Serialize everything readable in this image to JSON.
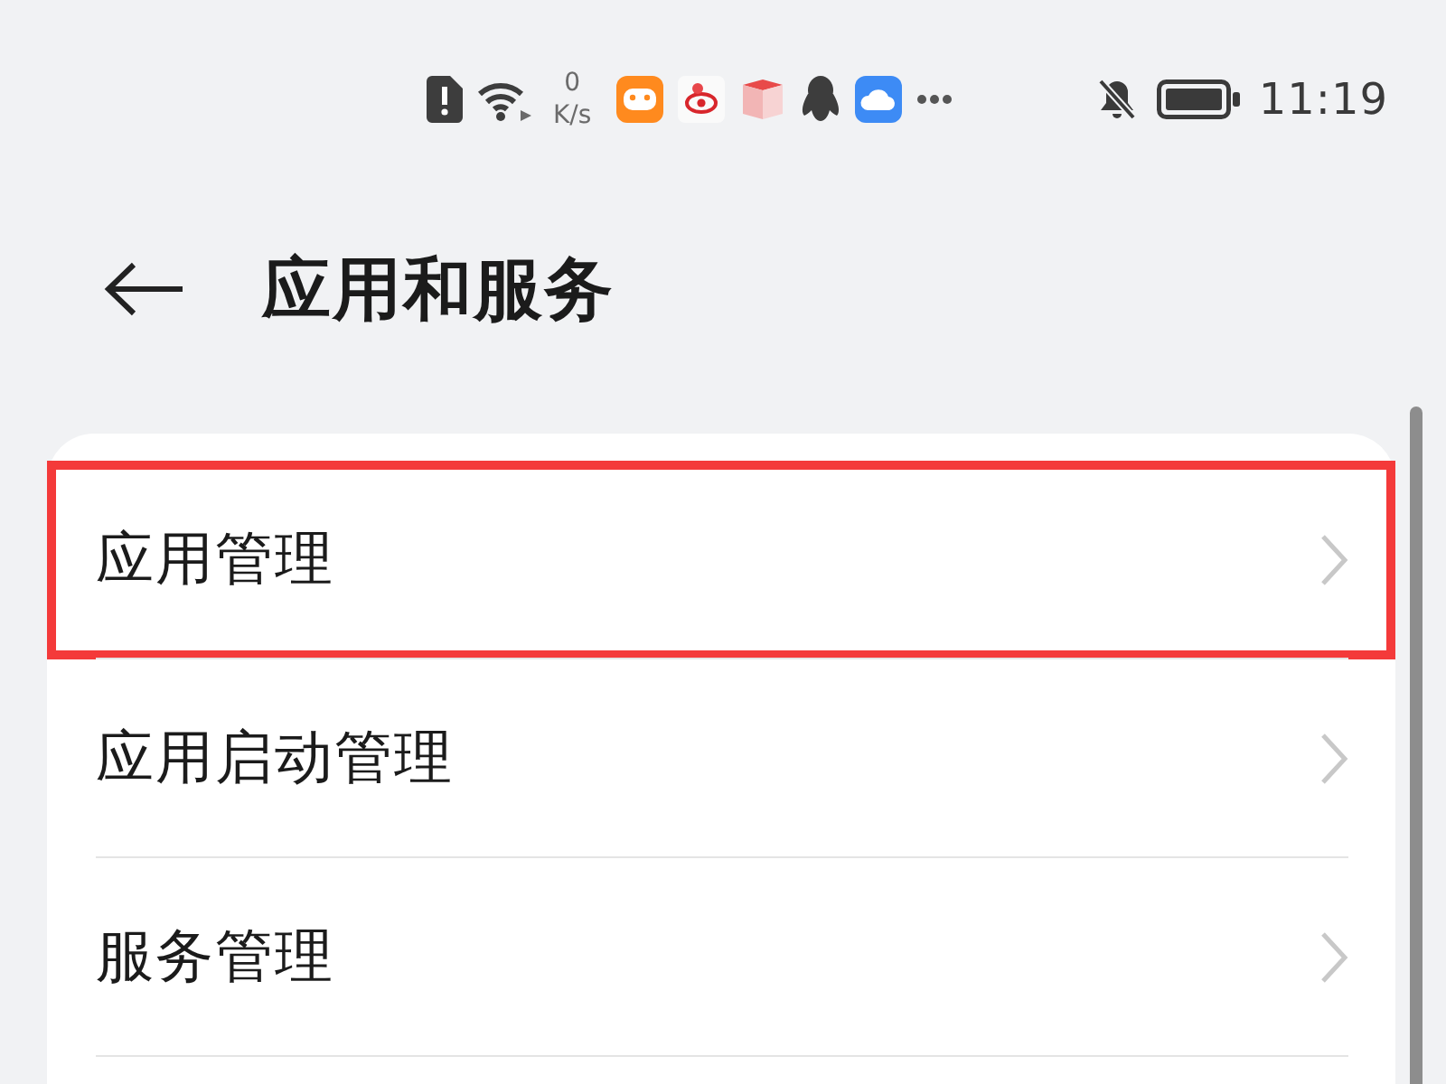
{
  "status_bar": {
    "speed_value": "0",
    "speed_unit": "K/s",
    "time": "11:19"
  },
  "header": {
    "title": "应用和服务"
  },
  "menu_items": [
    {
      "label": "应用管理",
      "highlighted": true
    },
    {
      "label": "应用启动管理",
      "highlighted": false
    },
    {
      "label": "服务管理",
      "highlighted": false
    }
  ]
}
